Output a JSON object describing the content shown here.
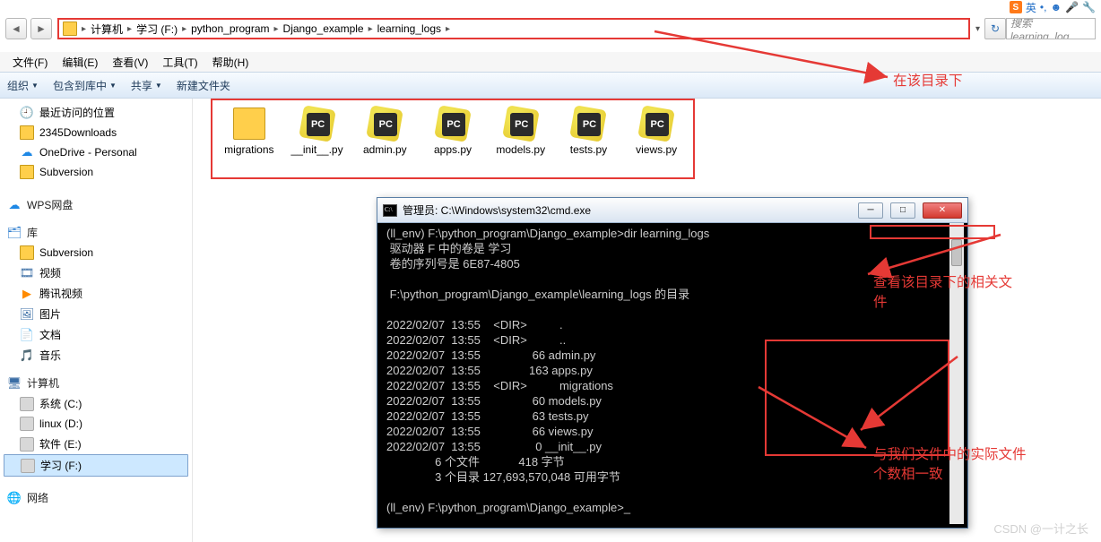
{
  "sogou": {
    "lang": "英",
    "punct": "•,",
    "face": "☻",
    "mic": "🎤",
    "tool": "🔧"
  },
  "address": {
    "crumbs": [
      "计算机",
      "学习 (F:)",
      "python_program",
      "Django_example",
      "learning_logs"
    ],
    "search_placeholder": "搜索 learning_log"
  },
  "menu": {
    "file": "文件(F)",
    "edit": "编辑(E)",
    "view": "查看(V)",
    "tools": "工具(T)",
    "help": "帮助(H)"
  },
  "toolbar": {
    "organize": "组织",
    "include": "包含到库中",
    "share": "共享",
    "newfolder": "新建文件夹"
  },
  "sidebar": {
    "recent": "最近访问的位置",
    "downloads": "2345Downloads",
    "onedrive": "OneDrive - Personal",
    "subversion": "Subversion",
    "wps": "WPS网盘",
    "lib_header": "库",
    "lib_svn": "Subversion",
    "lib_video": "视频",
    "lib_qqvideo": "腾讯视频",
    "lib_pic": "图片",
    "lib_doc": "文档",
    "lib_music": "音乐",
    "pc_header": "计算机",
    "drive_c": "系统 (C:)",
    "drive_d": "linux (D:)",
    "drive_e": "软件 (E:)",
    "drive_f": "学习 (F:)",
    "network": "网络"
  },
  "files": [
    {
      "name": "migrations",
      "type": "folder"
    },
    {
      "name": "__init__.py",
      "type": "pc"
    },
    {
      "name": "admin.py",
      "type": "pc"
    },
    {
      "name": "apps.py",
      "type": "pc"
    },
    {
      "name": "models.py",
      "type": "pc"
    },
    {
      "name": "tests.py",
      "type": "pc"
    },
    {
      "name": "views.py",
      "type": "pc"
    }
  ],
  "cmd": {
    "title": "管理员: C:\\Windows\\system32\\cmd.exe",
    "body": "(ll_env) F:\\python_program\\Django_example>dir learning_logs\n 驱动器 F 中的卷是 学习\n 卷的序列号是 6E87-4805\n\n F:\\python_program\\Django_example\\learning_logs 的目录\n\n2022/02/07  13:55    <DIR>          .\n2022/02/07  13:55    <DIR>          ..\n2022/02/07  13:55                66 admin.py\n2022/02/07  13:55               163 apps.py\n2022/02/07  13:55    <DIR>          migrations\n2022/02/07  13:55                60 models.py\n2022/02/07  13:55                63 tests.py\n2022/02/07  13:55                66 views.py\n2022/02/07  13:55                 0 __init__.py\n               6 个文件            418 字节\n               3 个目录 127,693,570,048 可用字节\n\n(ll_env) F:\\python_program\\Django_example>_"
  },
  "annotations": {
    "a1": "在该目录下",
    "a2": "查看该目录下的相关文\n件",
    "a3": "与我们文件中的实际文件\n个数相一致"
  },
  "watermark": "CSDN @一计之长"
}
